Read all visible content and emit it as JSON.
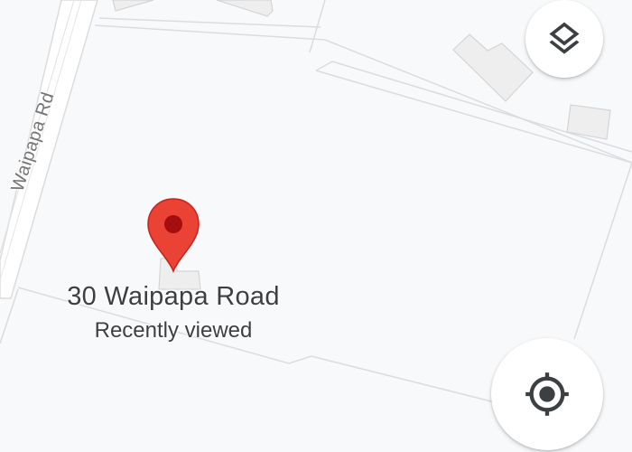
{
  "map": {
    "street_label": "Waipapa Rd",
    "place": {
      "title": "30 Waipapa Road",
      "subtitle": "Recently viewed"
    }
  },
  "controls": {
    "layers_icon": "layers-icon",
    "locate_icon": "my-location-icon"
  },
  "colors": {
    "background": "#f8f9fa",
    "pin_red": "#ea4335",
    "pin_dark": "#a50e0e",
    "icon": "#3c4043"
  }
}
